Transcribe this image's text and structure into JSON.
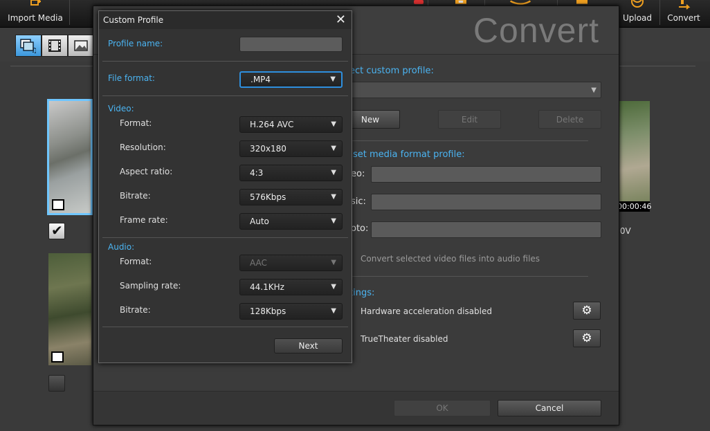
{
  "app_toolbar": {
    "import_label": "Import Media",
    "upload_label": "Upload",
    "convert_label": "Convert"
  },
  "library": {
    "thumb_time": "00:00:46",
    "thumb_label": ".0V"
  },
  "convert_window": {
    "title": "Convert",
    "select_custom_profile_label": "ect custom profile:",
    "new_label": "New",
    "edit_label": "Edit",
    "delete_label": "Delete",
    "preset_profile_label": "set media format profile:",
    "video_label": "eo:",
    "music_label": "sic:",
    "photo_label": "oto:",
    "convert_audio_label": "Convert selected video files into audio files",
    "settings_label": "tings:",
    "hw_accel_label": "Hardware acceleration disabled",
    "truetheater_label": "TrueTheater disabled",
    "ok_label": "OK",
    "cancel_label": "Cancel"
  },
  "dialog": {
    "title": "Custom Profile",
    "profile_name_label": "Profile name:",
    "profile_name_value": "",
    "file_format_label": "File format:",
    "file_format_value": ".MP4",
    "video_section": "Video:",
    "video_format_label": "Format:",
    "video_format_value": "H.264 AVC",
    "resolution_label": "Resolution:",
    "resolution_value": "320x180",
    "aspect_label": "Aspect ratio:",
    "aspect_value": "4:3",
    "video_bitrate_label": "Bitrate:",
    "video_bitrate_value": "576Kbps",
    "frame_rate_label": "Frame rate:",
    "frame_rate_value": "Auto",
    "audio_section": "Audio:",
    "audio_format_label": "Format:",
    "audio_format_value": "AAC",
    "sampling_label": "Sampling rate:",
    "sampling_value": "44.1KHz",
    "audio_bitrate_label": "Bitrate:",
    "audio_bitrate_value": "128Kbps",
    "next_label": "Next"
  },
  "colors": {
    "accent_blue": "#4bb4f2",
    "focus_border": "#2e8fde",
    "toolbar_icon_orange": "#f0a020"
  }
}
